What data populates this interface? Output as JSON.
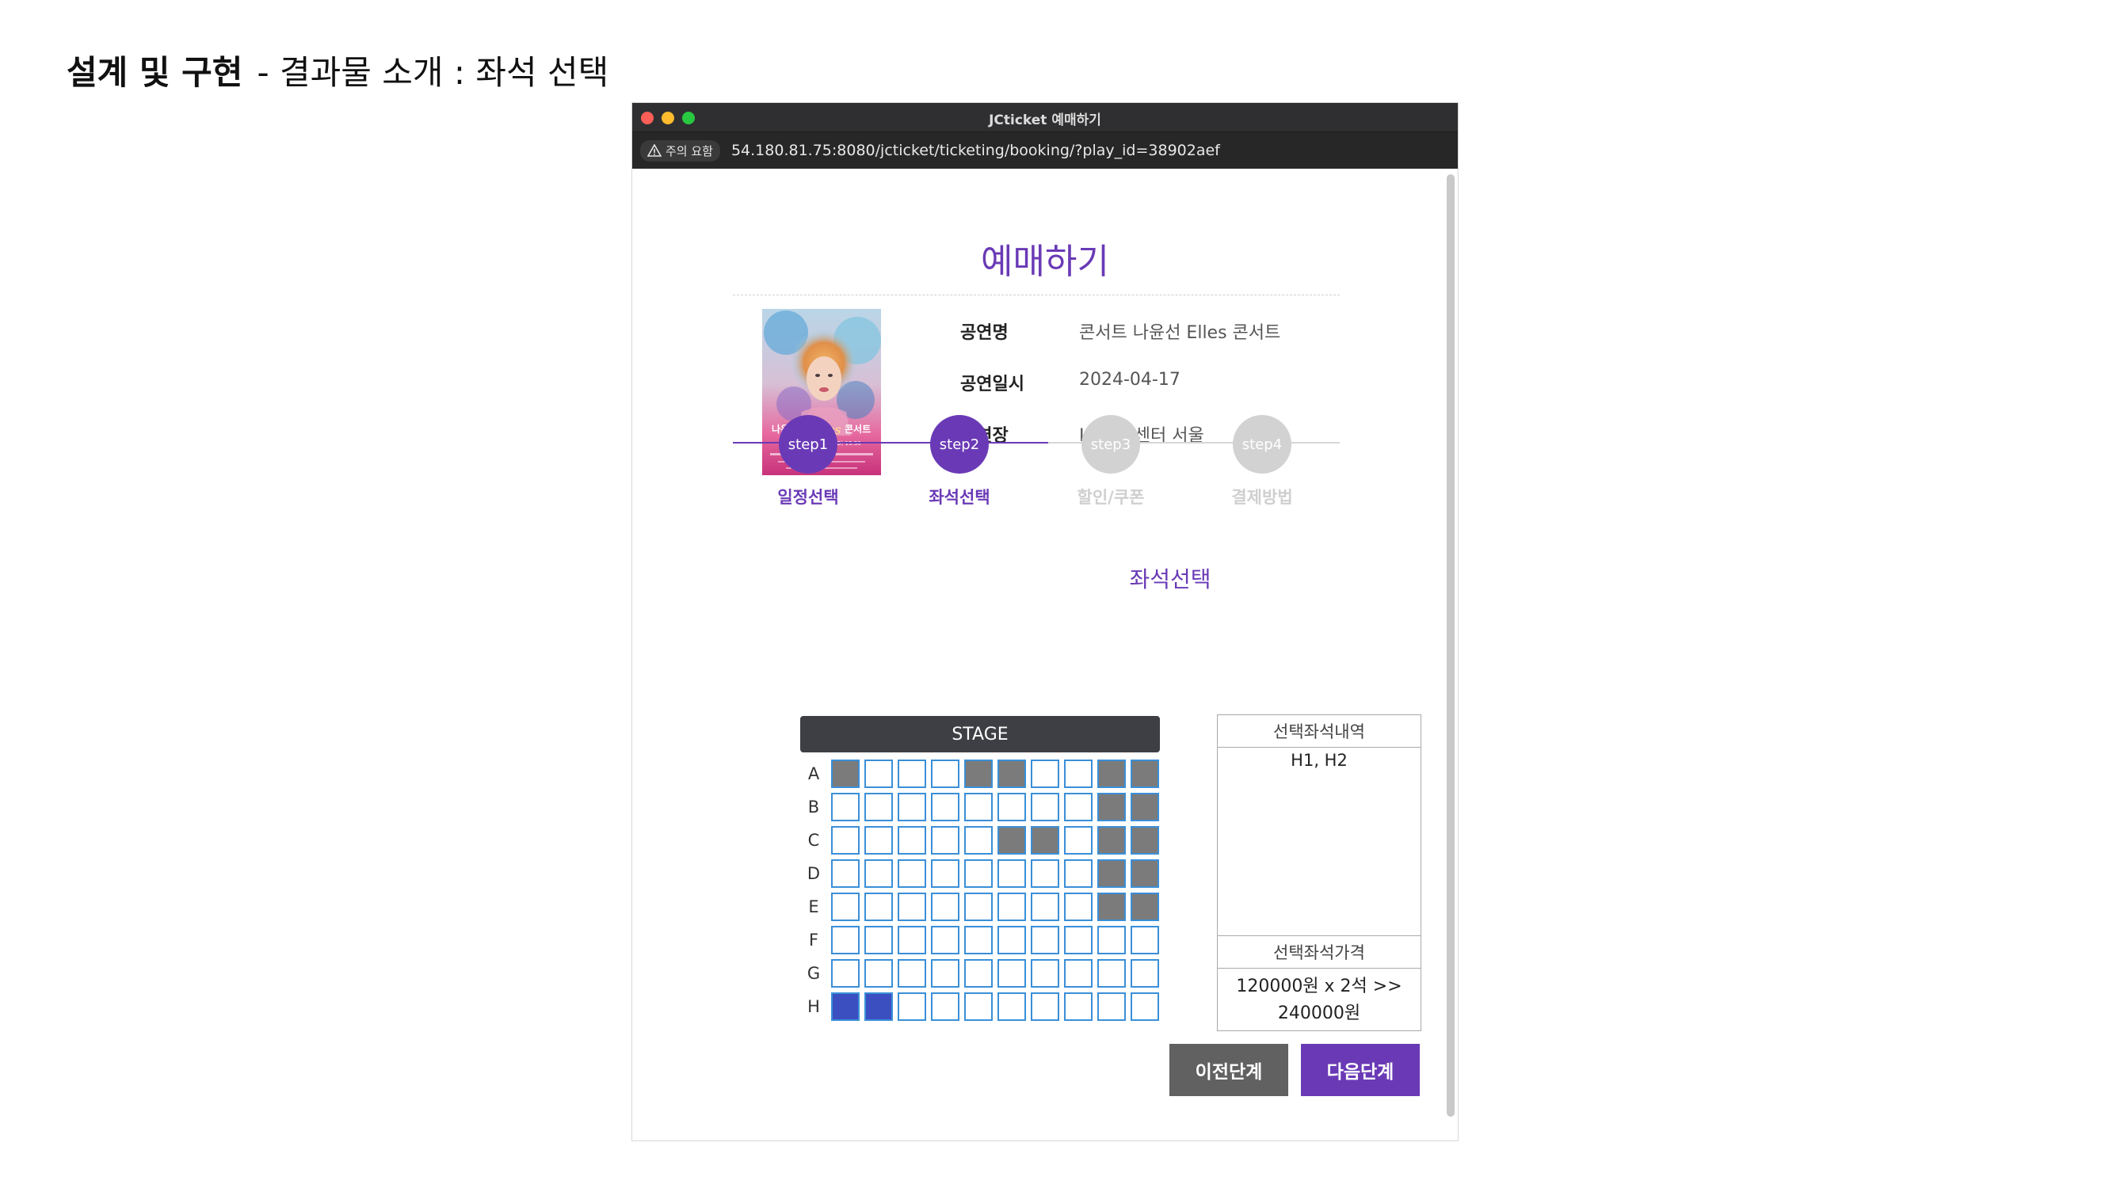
{
  "slide": {
    "title_bold": "설계 및 구현",
    "title_rest": "- 결과물 소개 :  좌석 선택"
  },
  "window": {
    "title": "JCticket 예매하기",
    "security_label": "주의 요함",
    "url": "54.180.81.75:8080/jcticket/ticketing/booking/?play_id=38902aef"
  },
  "page": {
    "title": "예매하기",
    "performance": {
      "name_label": "공연명",
      "name_value": "콘서트 나윤선 Elles 콘서트",
      "date_label": "공연일시",
      "date_value": "2024-04-17",
      "venue_label": "공연장",
      "venue_value": "LG아트센터 서울"
    },
    "poster": {
      "line1": "나윤선",
      "line2": "Elles",
      "line3": "콘서트",
      "date": "2024.04.17(WED) 19:30"
    },
    "steps": [
      {
        "circle": "step1",
        "label": "일정선택",
        "active": true
      },
      {
        "circle": "step2",
        "label": "좌석선택",
        "active": true
      },
      {
        "circle": "step3",
        "label": "할인/쿠폰",
        "active": false
      },
      {
        "circle": "step4",
        "label": "결제방법",
        "active": false
      }
    ],
    "section_title": "좌석선택",
    "stage_label": "STAGE",
    "rows": [
      {
        "label": "A",
        "seats": [
          "sold",
          "empty",
          "empty",
          "empty",
          "sold",
          "sold",
          "empty",
          "empty",
          "sold",
          "sold"
        ]
      },
      {
        "label": "B",
        "seats": [
          "empty",
          "empty",
          "empty",
          "empty",
          "empty",
          "empty",
          "empty",
          "empty",
          "sold",
          "sold"
        ]
      },
      {
        "label": "C",
        "seats": [
          "empty",
          "empty",
          "empty",
          "empty",
          "empty",
          "sold",
          "sold",
          "empty",
          "sold",
          "sold"
        ]
      },
      {
        "label": "D",
        "seats": [
          "empty",
          "empty",
          "empty",
          "empty",
          "empty",
          "empty",
          "empty",
          "empty",
          "sold",
          "sold"
        ]
      },
      {
        "label": "E",
        "seats": [
          "empty",
          "empty",
          "empty",
          "empty",
          "empty",
          "empty",
          "empty",
          "empty",
          "sold",
          "sold"
        ]
      },
      {
        "label": "F",
        "seats": [
          "empty",
          "empty",
          "empty",
          "empty",
          "empty",
          "empty",
          "empty",
          "empty",
          "empty",
          "empty"
        ]
      },
      {
        "label": "G",
        "seats": [
          "empty",
          "empty",
          "empty",
          "empty",
          "empty",
          "empty",
          "empty",
          "empty",
          "empty",
          "empty"
        ]
      },
      {
        "label": "H",
        "seats": [
          "selected",
          "selected",
          "empty",
          "empty",
          "empty",
          "empty",
          "empty",
          "empty",
          "empty",
          "empty"
        ]
      }
    ],
    "summary": {
      "seats_header": "선택좌석내역",
      "seats_value": "H1, H2",
      "price_header": "선택좌석가격",
      "price_line1": "120000원 x 2석 >>",
      "price_line2": "240000원"
    },
    "buttons": {
      "prev": "이전단계",
      "next": "다음단계"
    }
  },
  "colors": {
    "accent": "#6a3ab6",
    "sold_seat": "#7b7b7b",
    "selected_seat": "#3b4fc0",
    "seat_border": "#3a8fd8",
    "inactive_step": "#d2d2d2",
    "prev_button": "#616161",
    "window_close": "#ff5f57",
    "window_minimize": "#febc2e",
    "window_zoom": "#28c840"
  }
}
